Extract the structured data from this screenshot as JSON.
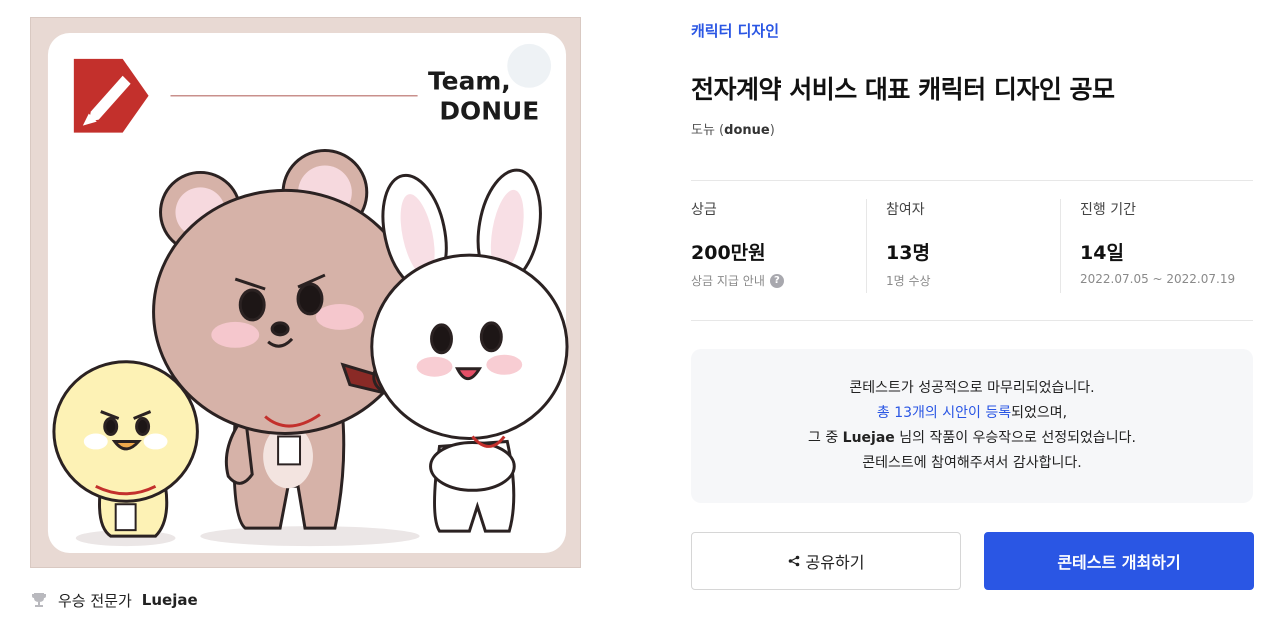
{
  "artwork": {
    "team_line1": "Team,",
    "team_line2": "DONUE"
  },
  "winner": {
    "prefix": "우승 전문가",
    "name": "Luejae",
    "icon": "trophy-icon"
  },
  "contest": {
    "category": "캐릭터 디자인",
    "title": "전자계약 서비스 대표 캐릭터 디자인 공모",
    "host_name": "도뉴",
    "host_id": "donue"
  },
  "stats": {
    "prize": {
      "label": "상금",
      "value": "200만원",
      "sub": "상금 지급 안내"
    },
    "participants": {
      "label": "참여자",
      "value": "13명",
      "sub": "1명 수상"
    },
    "period": {
      "label": "진행 기간",
      "value": "14일",
      "sub": "2022.07.05 ~ 2022.07.19"
    }
  },
  "notice": {
    "line1": "콘테스트가 성공적으로 마무리되었습니다.",
    "line2_link": "총 13개의 시안이 등록",
    "line2_rest": "되었으며,",
    "line3_pre": "그 중 ",
    "line3_name": "Luejae",
    "line3_post": " 님의 작품이 우승작으로 선정되었습니다.",
    "line4": "콘테스트에 참여해주셔서 감사합니다."
  },
  "buttons": {
    "share": "공유하기",
    "host": "콘테스트 개최하기"
  },
  "colors": {
    "accent": "#2a56e4",
    "notice_bg": "#f6f7f9",
    "logo_red": "#c3302c"
  }
}
